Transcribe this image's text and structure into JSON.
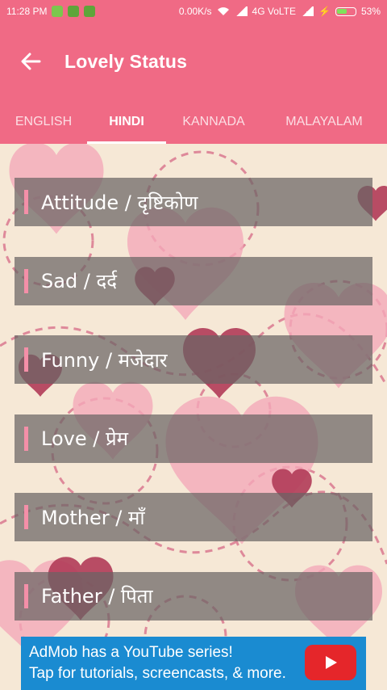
{
  "status_bar": {
    "time": "11:28 PM",
    "network_speed": "0.00K/s",
    "network_type": "4G VoLTE",
    "battery": "53%"
  },
  "app_bar": {
    "title": "Lovely Status",
    "back_icon": "arrow-back-icon"
  },
  "tabs": [
    {
      "label": "ENGLISH",
      "active": false
    },
    {
      "label": "HINDI",
      "active": true
    },
    {
      "label": "KANNADA",
      "active": false
    },
    {
      "label": "MALAYALAM",
      "active": false
    }
  ],
  "categories": [
    {
      "label": "Attitude /  दृष्टिकोण"
    },
    {
      "label": "Sad / दर्द"
    },
    {
      "label": "Funny / मजेदार"
    },
    {
      "label": "Love / प्रेम"
    },
    {
      "label": "Mother / माँ"
    },
    {
      "label": "Father / पिता"
    }
  ],
  "ad": {
    "line1": "AdMob has a YouTube series!",
    "line2": "Tap for tutorials, screencasts, & more.",
    "play_icon": "youtube-play-icon"
  },
  "colors": {
    "accent": "#f06a85",
    "ad_blue": "#1a8bd1",
    "ad_red": "#e5262a"
  }
}
